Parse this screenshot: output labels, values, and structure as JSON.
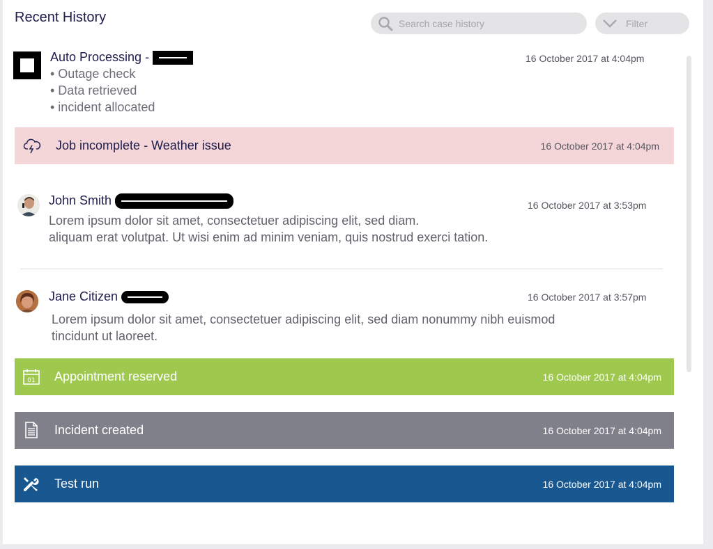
{
  "header": {
    "title": "Recent History",
    "search_placeholder": "Search case history",
    "filter_label": "Filter"
  },
  "entries": {
    "auto": {
      "name": "Auto Processing -",
      "time": "16 October 2017 at 4:04pm",
      "bullets": [
        "• Outage check",
        "• Data retrieved",
        "• incident allocated"
      ]
    },
    "job_incomplete": {
      "label": "Job incomplete - Weather issue",
      "time": "16 October 2017 at 4:04pm",
      "color": "#f5d6d8"
    },
    "john": {
      "name": "John Smith",
      "time": "16 October 2017 at 3:53pm",
      "line1": "Lorem ipsum dolor sit amet, consectetuer adipiscing elit, sed diam.",
      "line2": "aliquam erat volutpat. Ut wisi enim ad minim veniam, quis nostrud exerci tation."
    },
    "jane": {
      "name": "Jane Citizen",
      "time": "16 October 2017 at 3:57pm",
      "line1": "Lorem ipsum dolor sit amet, consectetuer adipiscing elit, sed diam nonummy nibh euismod",
      "line2": "tincidunt ut laoreet."
    },
    "appointment": {
      "label": "Appointment reserved",
      "time": "16 October 2017 at 4:04pm",
      "icon_text": "01",
      "color": "#9fc84e"
    },
    "incident": {
      "label": "Incident created",
      "time": "16 October 2017 at 4:04pm",
      "color": "#80808b"
    },
    "test_run": {
      "label": "Test run",
      "time": "16 October 2017 at 4:04pm",
      "color": "#18578f"
    }
  }
}
